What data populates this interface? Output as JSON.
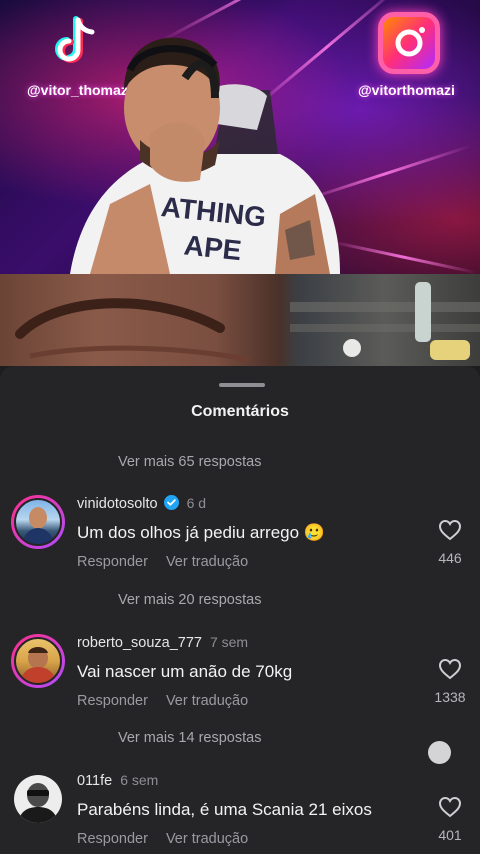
{
  "stream": {
    "tiktok_handle": "@vitor_thomaz",
    "instagram_handle": "@vitorthomazi",
    "shirt_text": [
      "ATHING",
      "APE"
    ]
  },
  "sheet": {
    "title": "Comentários"
  },
  "replies": {
    "top": "Ver mais 65 respostas",
    "middle": "Ver mais 20 respostas",
    "bottom": "Ver mais 14 respostas"
  },
  "comments": [
    {
      "username": "vinidotosolto",
      "verified": true,
      "time": "6 d",
      "text": "Um dos olhos já pediu arrego 🥲",
      "reply_label": "Responder",
      "translate_label": "Ver tradução",
      "likes": "446",
      "icon": "heart-outline-icon"
    },
    {
      "username": "roberto_souza_777",
      "verified": false,
      "time": "7 sem",
      "text": "Vai nascer um anão de 70kg",
      "reply_label": "Responder",
      "translate_label": "Ver tradução",
      "likes": "1338",
      "icon": "heart-outline-icon"
    },
    {
      "username": "011fe",
      "verified": false,
      "time": "6 sem",
      "text": "Parabéns linda, é uma Scania 21 eixos",
      "reply_label": "Responder",
      "translate_label": "Ver tradução",
      "likes": "401",
      "icon": "heart-outline-icon"
    }
  ],
  "colors": {
    "sheet_background": "#252527",
    "accent_ring": "#ff2e8a",
    "verified_badge": "#20a5f5"
  }
}
